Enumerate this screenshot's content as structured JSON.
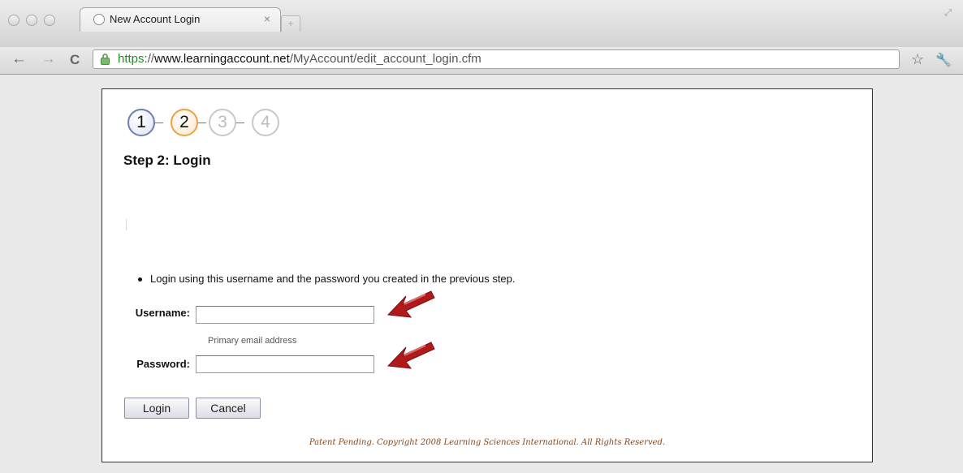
{
  "browser": {
    "tab_title": "New Account Login",
    "tab_close": "×",
    "new_tab": "+",
    "url_scheme": "https",
    "url_sep": "://",
    "url_host": "www.learningaccount.net",
    "url_path": "/MyAccount/edit_account_login.cfm",
    "back": "←",
    "forward": "→",
    "reload": "C",
    "star": "☆",
    "wrench": "🔧",
    "resize": "⤢"
  },
  "steps": [
    {
      "label": "1",
      "state": "completed",
      "color": "#6f7fb0"
    },
    {
      "label": "2",
      "state": "current",
      "color": "#e9a24b"
    },
    {
      "label": "3",
      "state": "upcoming",
      "color": "#c8c8c8"
    },
    {
      "label": "4",
      "state": "upcoming",
      "color": "#c8c8c8"
    }
  ],
  "heading": "Step 2: Login",
  "instruction": "Login using this username and the password you created in the previous step.",
  "form": {
    "username_label": "Username:",
    "username_value": "",
    "username_hint": "Primary email address",
    "password_label": "Password:",
    "password_value": ""
  },
  "buttons": {
    "login": "Login",
    "cancel": "Cancel"
  },
  "footer": "Patent Pending. Copyright 2008 Learning Sciences International. All Rights Reserved.",
  "colors": {
    "arrow": "#b01a1a",
    "footer_text": "#8b4513",
    "secure_scheme": "#1f8f1f"
  }
}
